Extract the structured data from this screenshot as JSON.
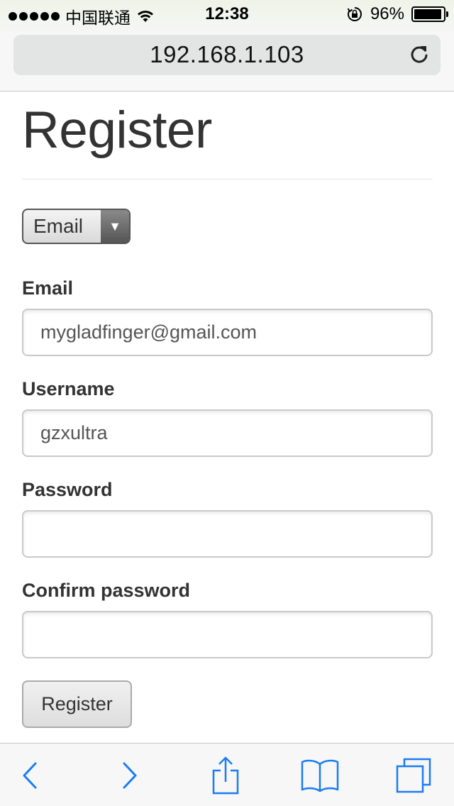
{
  "status_bar": {
    "carrier": "中国联通",
    "time": "12:38",
    "battery_percent": "96%",
    "battery_level": 0.96
  },
  "browser": {
    "url": "192.168.1.103",
    "accent_color": "#1a7cf4"
  },
  "page": {
    "title": "Register",
    "login_type_select": {
      "selected": "Email"
    },
    "fields": {
      "email": {
        "label": "Email",
        "value": "mygladfinger@gmail.com"
      },
      "username": {
        "label": "Username",
        "value": "gzxultra"
      },
      "password": {
        "label": "Password",
        "value": ""
      },
      "confirm_password": {
        "label": "Confirm password",
        "value": ""
      }
    },
    "submit_label": "Register"
  },
  "toolbar": {
    "icons": [
      "back-icon",
      "forward-icon",
      "share-icon",
      "bookmarks-icon",
      "tabs-icon"
    ]
  }
}
